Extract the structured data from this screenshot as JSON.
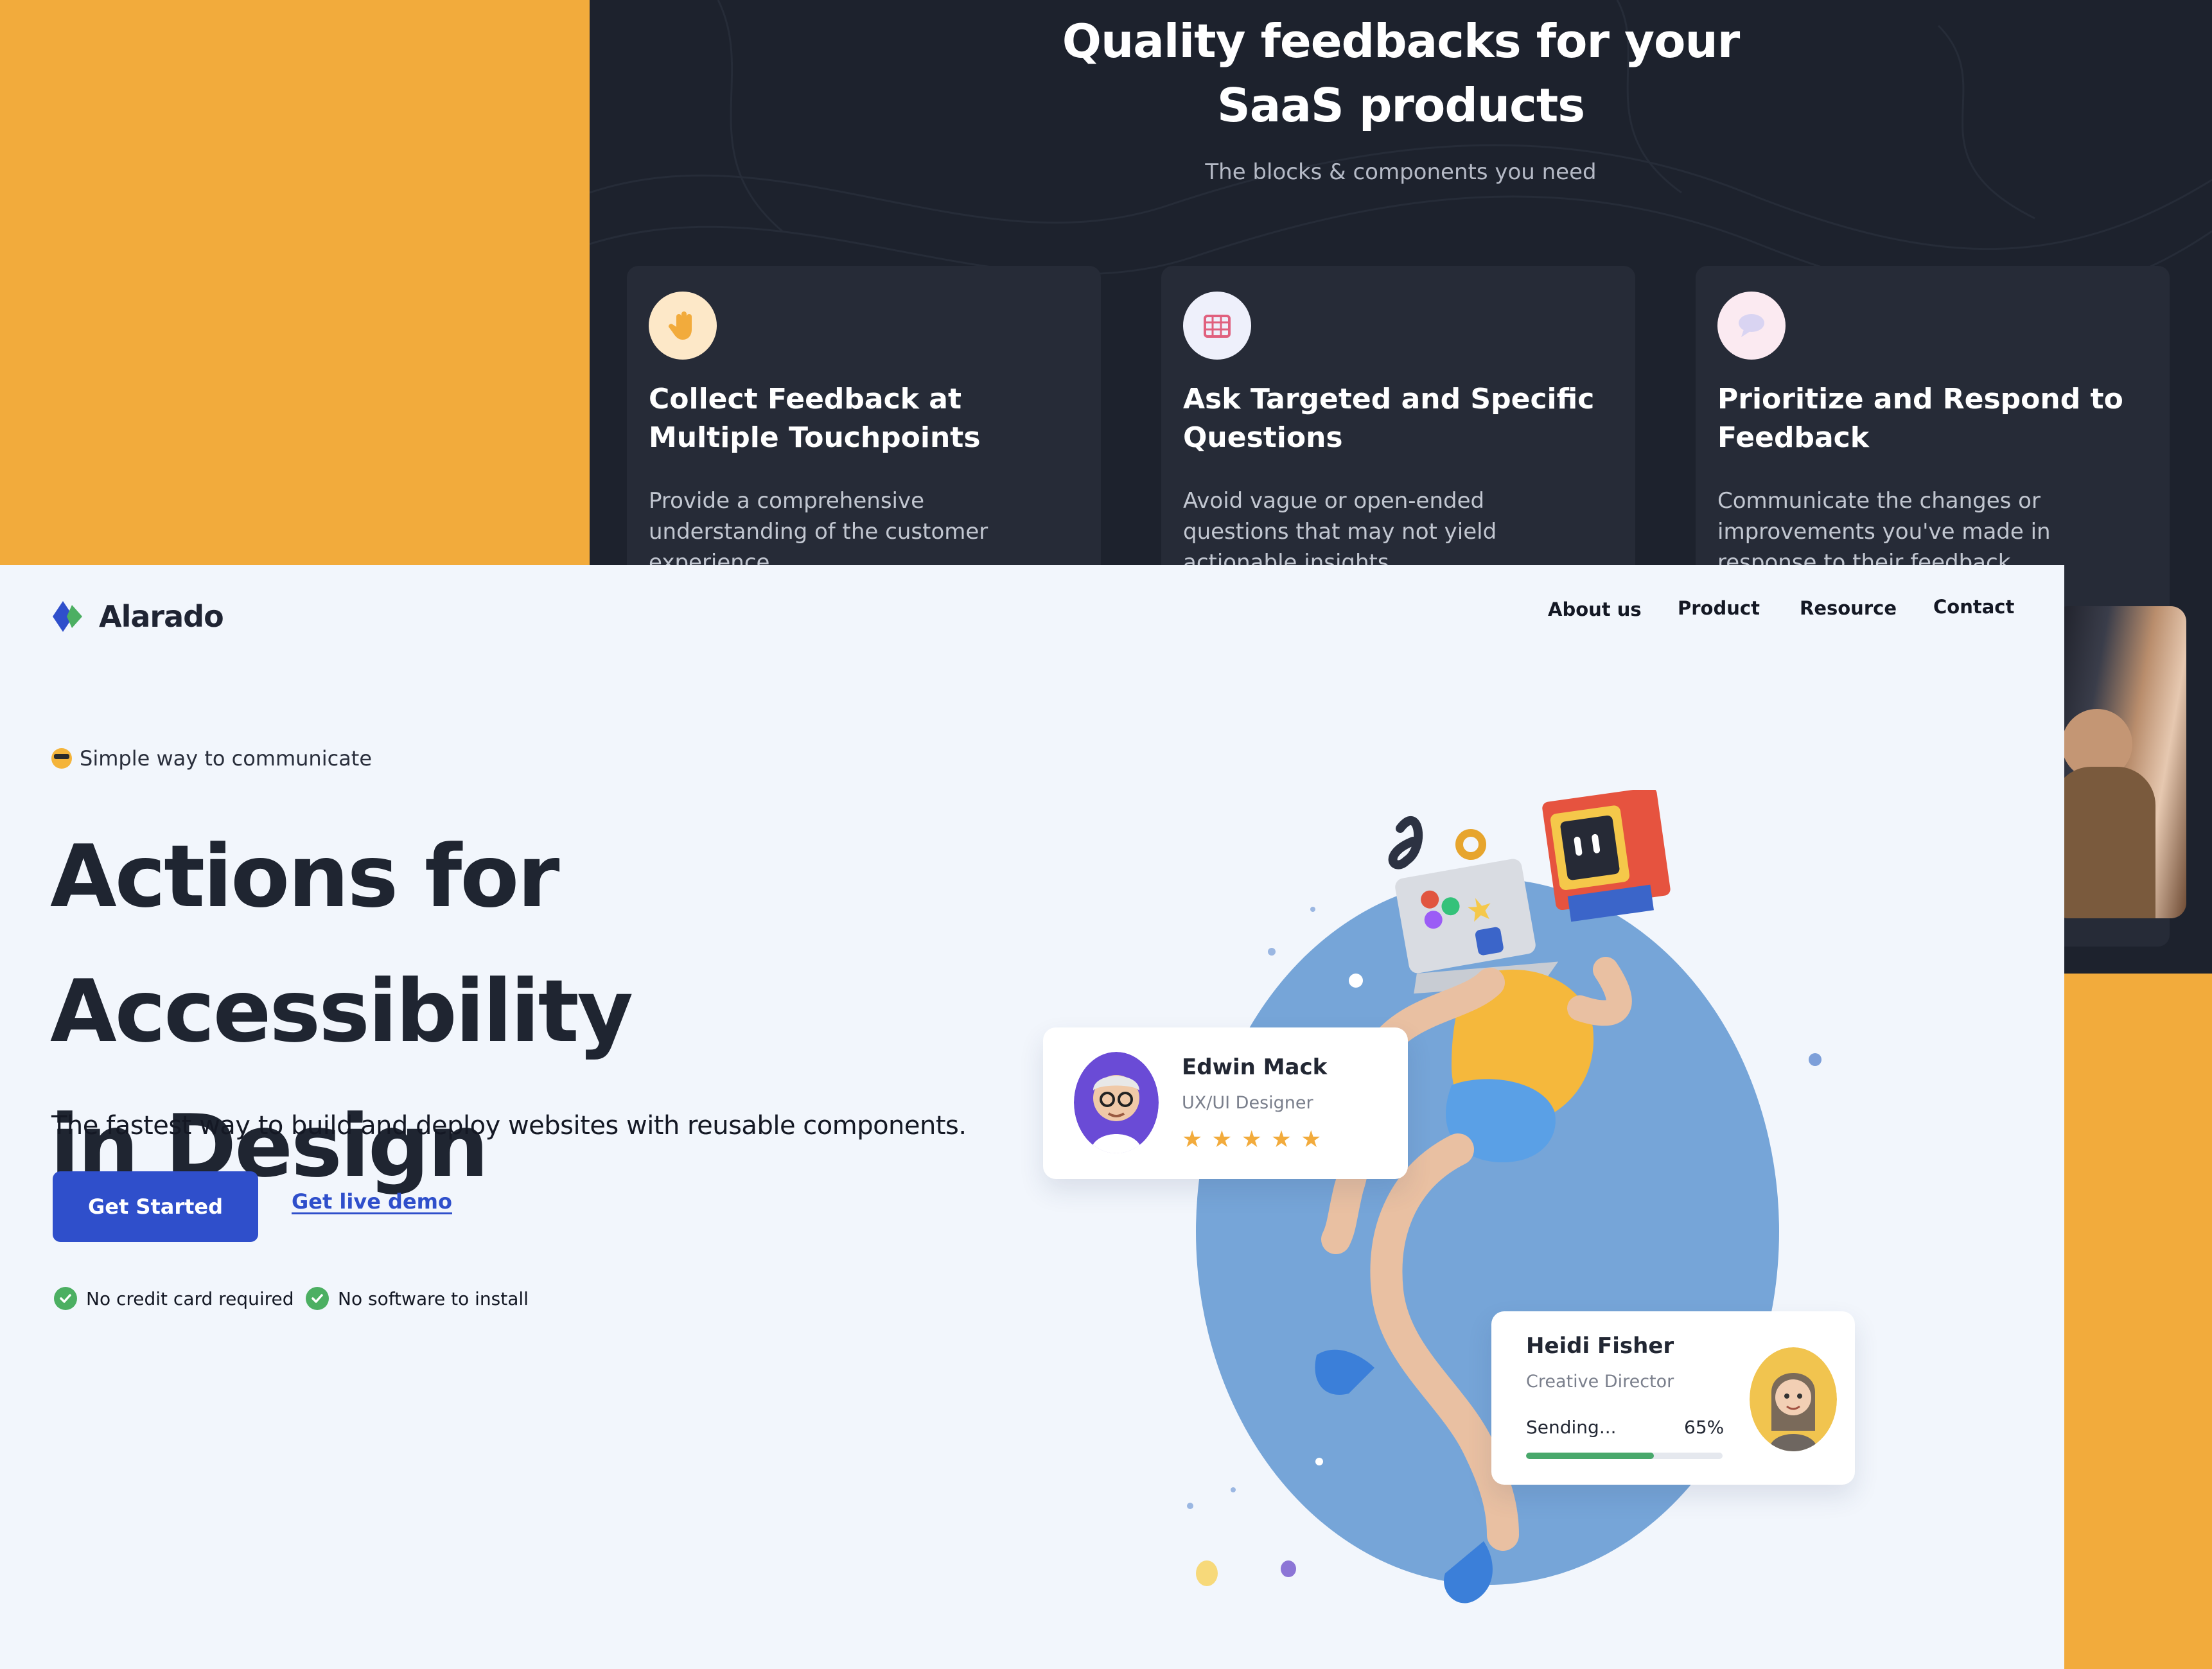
{
  "back_screen": {
    "title_line1": "Quality feedbacks for your",
    "title_line2": "SaaS products",
    "subtitle": "The blocks & components you need",
    "features": [
      {
        "icon": "hand-icon",
        "icon_bg": "#fde8c8",
        "title": "Collect Feedback at Multiple Touchpoints",
        "desc": "Provide a comprehensive understanding of the customer experience"
      },
      {
        "icon": "calendar-grid-icon",
        "icon_bg": "#eef0fb",
        "title": "Ask Targeted and Specific Questions",
        "desc": "Avoid vague or open-ended questions that may not yield actionable insights"
      },
      {
        "icon": "chat-bubble-icon",
        "icon_bg": "#fbeaf1",
        "title": "Prioritize and Respond to Feedback",
        "desc": "Communicate the changes or improvements you've made in response to their feedback"
      }
    ]
  },
  "front_screen": {
    "brand": {
      "name": "Alarado",
      "colors": [
        "#2f4fcb",
        "#4caf62"
      ]
    },
    "nav": {
      "items": [
        "About us",
        "Product",
        "Resource",
        "Contact"
      ]
    },
    "hero": {
      "tagline": "Simple way to communicate",
      "headline_line1": "Actions for Accessibility",
      "headline_line2": "in Design",
      "lead": "The fastest way to build and deploy websites with reusable components.",
      "cta_primary": "Get Started",
      "cta_secondary": "Get live demo",
      "checks": [
        "No credit card required",
        "No software to install"
      ]
    },
    "profile_card": {
      "name": "Edwin Mack",
      "role": "UX/UI Designer",
      "rating": 5,
      "rating_max": 5
    },
    "upload_card": {
      "name": "Heidi Fisher",
      "role": "Creative Director",
      "status": "Sending...",
      "percent_label": "65%",
      "progress": 0.65
    }
  },
  "colors": {
    "accent": "#2f4fcb",
    "background_orange": "#f2ab3c",
    "dark_bg": "#1d222d",
    "light_bg": "#f2f6fc",
    "success": "#4caf62"
  }
}
